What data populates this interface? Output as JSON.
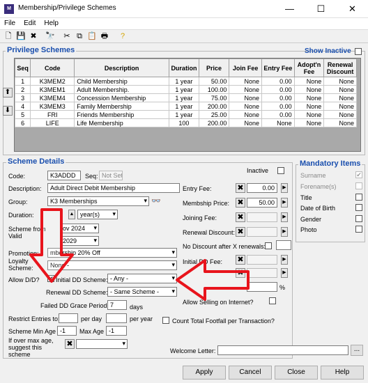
{
  "window": {
    "title": "Membership/Privilege Schemes",
    "minimize": "—",
    "maximize": "☐",
    "close": "✕"
  },
  "menu": [
    "File",
    "Edit",
    "Help"
  ],
  "privilege": {
    "title": "Privilege Schemes",
    "show_inactive": "Show Inactive",
    "columns": [
      "Seq",
      "Code",
      "Description",
      "Duration",
      "Price",
      "Join Fee",
      "Entry Fee",
      "Adopt'n Fee",
      "Renewal Discount"
    ],
    "rows": [
      [
        "1",
        "K3MEM2",
        "Child Membership",
        "1 year",
        "50.00",
        "None",
        "0.00",
        "None",
        "None"
      ],
      [
        "2",
        "K3MEM1",
        "Adult Membership.",
        "1 year",
        "100.00",
        "None",
        "0.00",
        "None",
        "None"
      ],
      [
        "3",
        "K3MEM4",
        "Concession Membership",
        "1 year",
        "75.00",
        "None",
        "0.00",
        "None",
        "None"
      ],
      [
        "4",
        "K3MEM3",
        "Family Membership",
        "1 year",
        "200.00",
        "None",
        "0.00",
        "None",
        "None"
      ],
      [
        "5",
        "FRI",
        "Friends Membership",
        "1 year",
        "25.00",
        "None",
        "0.00",
        "None",
        "None"
      ],
      [
        "6",
        "LIFE",
        "Life Membership",
        "100",
        "200.00",
        "None",
        "None",
        "None",
        "None"
      ]
    ]
  },
  "details": {
    "title": "Scheme Details",
    "code_label": "Code:",
    "code": "K3ADDD",
    "seq_label": "Seq:",
    "seq": "Not Set",
    "inactive_label": "Inactive",
    "desc_label": "Description:",
    "desc": "Adult Direct Debit Membership",
    "group_label": "Group:",
    "group": "K3 Memberships",
    "duration_label": "Duration:",
    "duration_unit": "year(s)",
    "from_label": "Scheme from",
    "from_value": "ov 2024",
    "valid_label": "Valid",
    "valid_value": "2029",
    "promotion_label": "Promotion:",
    "promotion": "mbership 20% Off",
    "loyalty_label": "Loyalty Scheme:",
    "loyalty": "None -",
    "allowdd_label": "Allow D/D?",
    "initial_dd_label": "Initial DD Scheme:",
    "initial_dd": "- Any -",
    "renewal_dd_label": "Renewal DD Scheme:",
    "renewal_dd": "- Same Scheme -",
    "failed_label": "Failed DD Grace Period:",
    "failed_value": "7",
    "days": "days",
    "restrict_label": "Restrict Entries to:",
    "per_day": "per day",
    "per_year": "per year",
    "min_age_label": "Scheme Min Age",
    "min_age": "-1",
    "max_age_label": "Max Age",
    "max_age": "-1",
    "over_max_label": "If over max age, suggest this scheme",
    "entry_fee_label": "Entry Fee:",
    "entry_fee": "0.00",
    "price_label": "Membship Price:",
    "price": "50.00",
    "joining_label": "Joining Fee:",
    "renewal_disc_label": "Renewal Discount:",
    "no_discount_label": "No Discount after X renewals:",
    "initial_fee_label": "Initial DD Fee:",
    "percent": "%",
    "allow_internet_label": "Allow Selling on Internet?",
    "footfall_label": "Count Total Footfall per Transaction?",
    "welcome_label": "Welcome Letter:",
    "browse": "..."
  },
  "mandatory": {
    "title": "Mandatory Items",
    "items": [
      "Surname",
      "Forename(s)",
      "Title",
      "Date of Birth",
      "Gender",
      "Photo"
    ]
  },
  "buttons": {
    "apply": "Apply",
    "cancel": "Cancel",
    "close": "Close",
    "help": "Help"
  },
  "colors": {
    "arrow": "#e8141c",
    "accent": "#1a4fae"
  }
}
